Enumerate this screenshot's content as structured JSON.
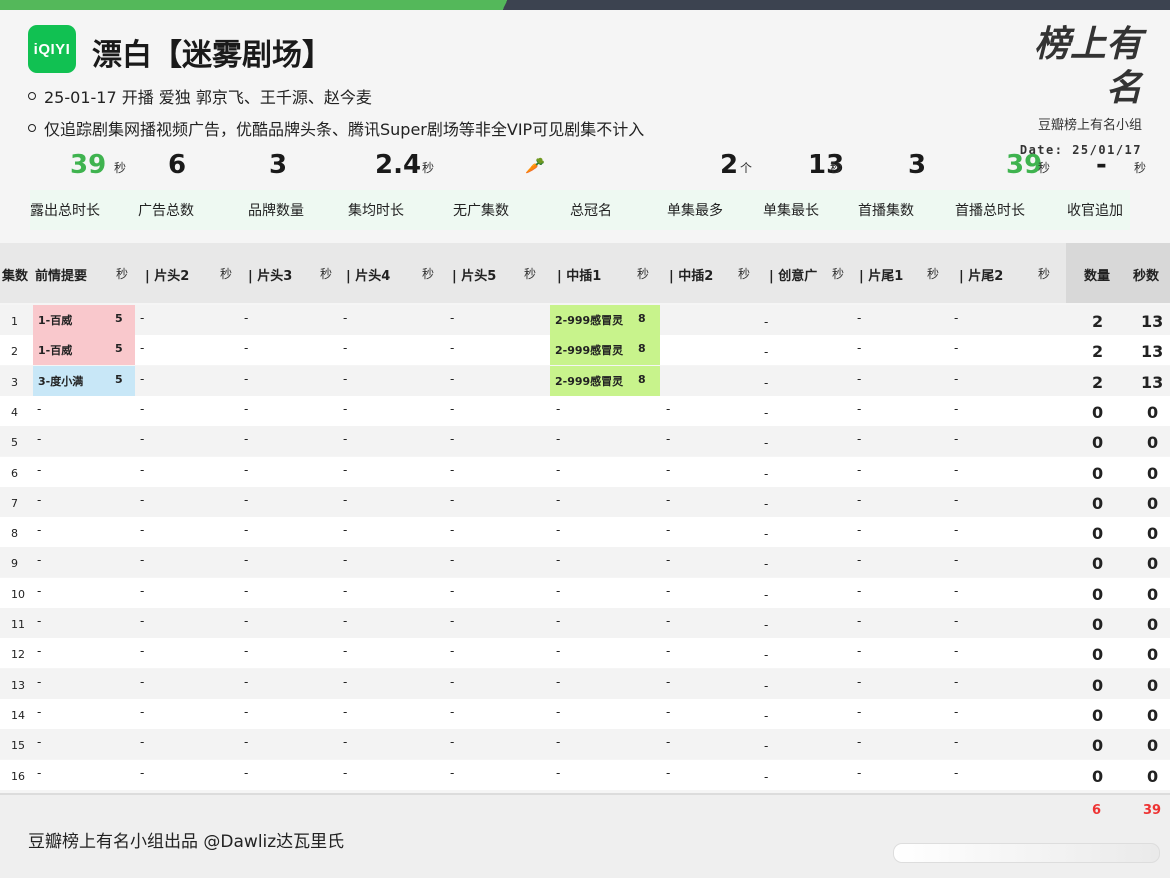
{
  "header": {
    "logo_text": "iQIYI",
    "title": "漂白【迷雾剧场】",
    "line1": "25-01-17 开播 爱独 郭京飞、王千源、赵今麦",
    "line2": "仅追踪剧集网播视频广告，优酷品牌头条、腾讯Super剧场等非全VIP可见剧集不计入",
    "brand_calligraphy": "榜上有名",
    "brand_group": "豆瓣榜上有名小组",
    "date": "Date: 25/01/17"
  },
  "stats": [
    {
      "value": "39",
      "unit": "秒",
      "label": "露出总时长",
      "color": "#3fb34f"
    },
    {
      "value": "6",
      "unit": "",
      "label": "广告总数",
      "color": "#1a1a1a"
    },
    {
      "value": "3",
      "unit": "",
      "label": "品牌数量",
      "color": "#1a1a1a"
    },
    {
      "value": "2.4",
      "unit": "秒",
      "label": "集均时长",
      "color": "#1a1a1a"
    },
    {
      "value": "",
      "unit": "",
      "label": "无广集数",
      "color": "#1a1a1a"
    },
    {
      "value": "🥕",
      "unit": "",
      "label": "总冠名",
      "color": "#1a1a1a"
    },
    {
      "value": "2",
      "unit": "个",
      "label": "单集最多",
      "color": "#1a1a1a"
    },
    {
      "value": "13",
      "unit": "秒",
      "label": "单集最长",
      "color": "#1a1a1a"
    },
    {
      "value": "3",
      "unit": "",
      "label": "首播集数",
      "color": "#1a1a1a"
    },
    {
      "value": "39",
      "unit": "秒",
      "label": "首播总时长",
      "color": "#3fb34f"
    },
    {
      "value": "-",
      "unit": "秒",
      "label": "收官追加",
      "color": "#1a1a1a"
    }
  ],
  "table": {
    "headers": [
      "集数",
      "前情提要",
      "秒",
      "| 片头2",
      "秒",
      "| 片头3",
      "秒",
      "| 片头4",
      "秒",
      "| 片头5",
      "秒",
      "| 中插1",
      "秒",
      "| 中插2",
      "秒",
      "| 创意广",
      "秒",
      "| 片尾1",
      "秒",
      "| 片尾2",
      "秒",
      "数量",
      "秒数"
    ],
    "rows": [
      {
        "ep": "1",
        "recap": "1-百威",
        "recap_sec": "5",
        "recap_color": "red",
        "mid1": "2-999感冒灵",
        "mid1_sec": "8",
        "count": "2",
        "secs": "13"
      },
      {
        "ep": "2",
        "recap": "1-百威",
        "recap_sec": "5",
        "recap_color": "red",
        "mid1": "2-999感冒灵",
        "mid1_sec": "8",
        "count": "2",
        "secs": "13"
      },
      {
        "ep": "3",
        "recap": "3-度小满",
        "recap_sec": "5",
        "recap_color": "blue",
        "mid1": "2-999感冒灵",
        "mid1_sec": "8",
        "count": "2",
        "secs": "13"
      },
      {
        "ep": "4",
        "recap": "-",
        "recap_sec": "",
        "recap_color": "",
        "mid1": "-",
        "mid1_sec": "",
        "count": "0",
        "secs": "0"
      },
      {
        "ep": "5",
        "recap": "-",
        "recap_sec": "",
        "recap_color": "",
        "mid1": "-",
        "mid1_sec": "",
        "count": "0",
        "secs": "0"
      },
      {
        "ep": "6",
        "recap": "-",
        "recap_sec": "",
        "recap_color": "",
        "mid1": "-",
        "mid1_sec": "",
        "count": "0",
        "secs": "0"
      },
      {
        "ep": "7",
        "recap": "-",
        "recap_sec": "",
        "recap_color": "",
        "mid1": "-",
        "mid1_sec": "",
        "count": "0",
        "secs": "0"
      },
      {
        "ep": "8",
        "recap": "-",
        "recap_sec": "",
        "recap_color": "",
        "mid1": "-",
        "mid1_sec": "",
        "count": "0",
        "secs": "0"
      },
      {
        "ep": "9",
        "recap": "-",
        "recap_sec": "",
        "recap_color": "",
        "mid1": "-",
        "mid1_sec": "",
        "count": "0",
        "secs": "0"
      },
      {
        "ep": "10",
        "recap": "-",
        "recap_sec": "",
        "recap_color": "",
        "mid1": "-",
        "mid1_sec": "",
        "count": "0",
        "secs": "0"
      },
      {
        "ep": "11",
        "recap": "-",
        "recap_sec": "",
        "recap_color": "",
        "mid1": "-",
        "mid1_sec": "",
        "count": "0",
        "secs": "0"
      },
      {
        "ep": "12",
        "recap": "-",
        "recap_sec": "",
        "recap_color": "",
        "mid1": "-",
        "mid1_sec": "",
        "count": "0",
        "secs": "0"
      },
      {
        "ep": "13",
        "recap": "-",
        "recap_sec": "",
        "recap_color": "",
        "mid1": "-",
        "mid1_sec": "",
        "count": "0",
        "secs": "0"
      },
      {
        "ep": "14",
        "recap": "-",
        "recap_sec": "",
        "recap_color": "",
        "mid1": "-",
        "mid1_sec": "",
        "count": "0",
        "secs": "0"
      },
      {
        "ep": "15",
        "recap": "-",
        "recap_sec": "",
        "recap_color": "",
        "mid1": "-",
        "mid1_sec": "",
        "count": "0",
        "secs": "0"
      },
      {
        "ep": "16",
        "recap": "-",
        "recap_sec": "",
        "recap_color": "",
        "mid1": "-",
        "mid1_sec": "",
        "count": "0",
        "secs": "0"
      }
    ],
    "empty_cell": "-"
  },
  "footer": {
    "credit": "豆瓣榜上有名小组出品 @Dawliz达瓦里氏",
    "total_count": "6",
    "total_secs": "39"
  }
}
